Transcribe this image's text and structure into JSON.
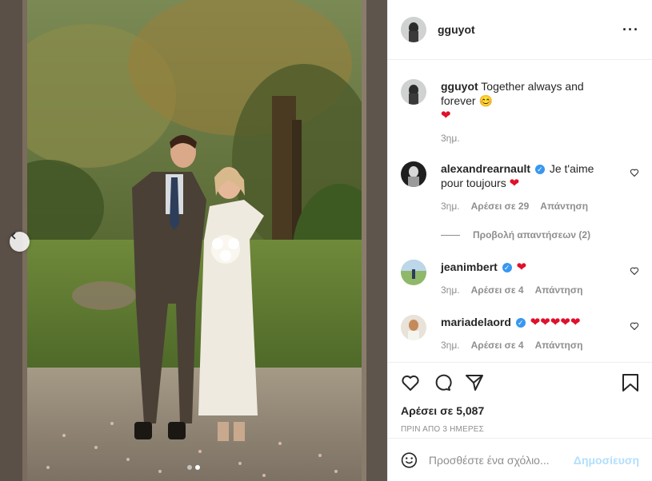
{
  "header": {
    "username": "gguyot",
    "more_icon": "more-options-icon",
    "more_label": "···"
  },
  "caption": {
    "username": "gguyot",
    "text": "Together always and forever 😊",
    "emoji": "❤",
    "time": "3ημ."
  },
  "comments": [
    {
      "username": "alexandrearnault",
      "verified": true,
      "text": "Je t'aime pour toujours",
      "emoji": "❤",
      "time": "3ημ.",
      "likes": "Αρέσει σε 29",
      "reply": "Απάντηση"
    },
    {
      "username": "jeanimbert",
      "verified": true,
      "text": "",
      "emoji": "❤",
      "time": "3ημ.",
      "likes": "Αρέσει σε 4",
      "reply": "Απάντηση"
    },
    {
      "username": "mariadelaord",
      "verified": true,
      "text": "",
      "emoji": "❤❤❤❤❤",
      "time": "3ημ.",
      "likes": "Αρέσει σε 4",
      "reply": "Απάντηση"
    }
  ],
  "view_replies": "Προβολή απαντήσεων (2)",
  "actions": {
    "likes": "Αρέσει σε 5,087",
    "date": "ΠΡΙΝ ΑΠΟ 3 ΗΜΕΡΕΣ"
  },
  "add_comment": {
    "placeholder": "Προσθέστε ένα σχόλιο...",
    "post_label": "Δημοσίευση"
  },
  "carousel": {
    "current": 2,
    "total": 2
  }
}
